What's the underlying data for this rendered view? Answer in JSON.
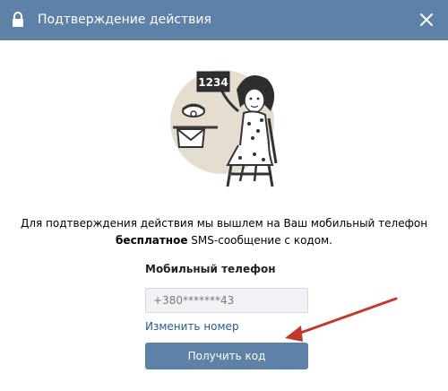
{
  "header": {
    "title": "Подтверждение действия",
    "icon": "lock-icon",
    "close_icon": "close-icon",
    "background": "#5e81a8"
  },
  "illustration": {
    "sign_text": "1234"
  },
  "message": {
    "line1": "Для подтверждения действия мы вышлем на Ваш мобильный телефон",
    "line2_bold": "бесплатное",
    "line2_rest": " SMS-сообщение с кодом."
  },
  "form": {
    "phone_label": "Мобильный телефон",
    "phone_value": "+380*******43",
    "change_link": "Изменить номер",
    "submit_label": "Получить код"
  },
  "colors": {
    "accent": "#5e81a8",
    "link": "#2a5885",
    "arrow": "#c0392b"
  }
}
